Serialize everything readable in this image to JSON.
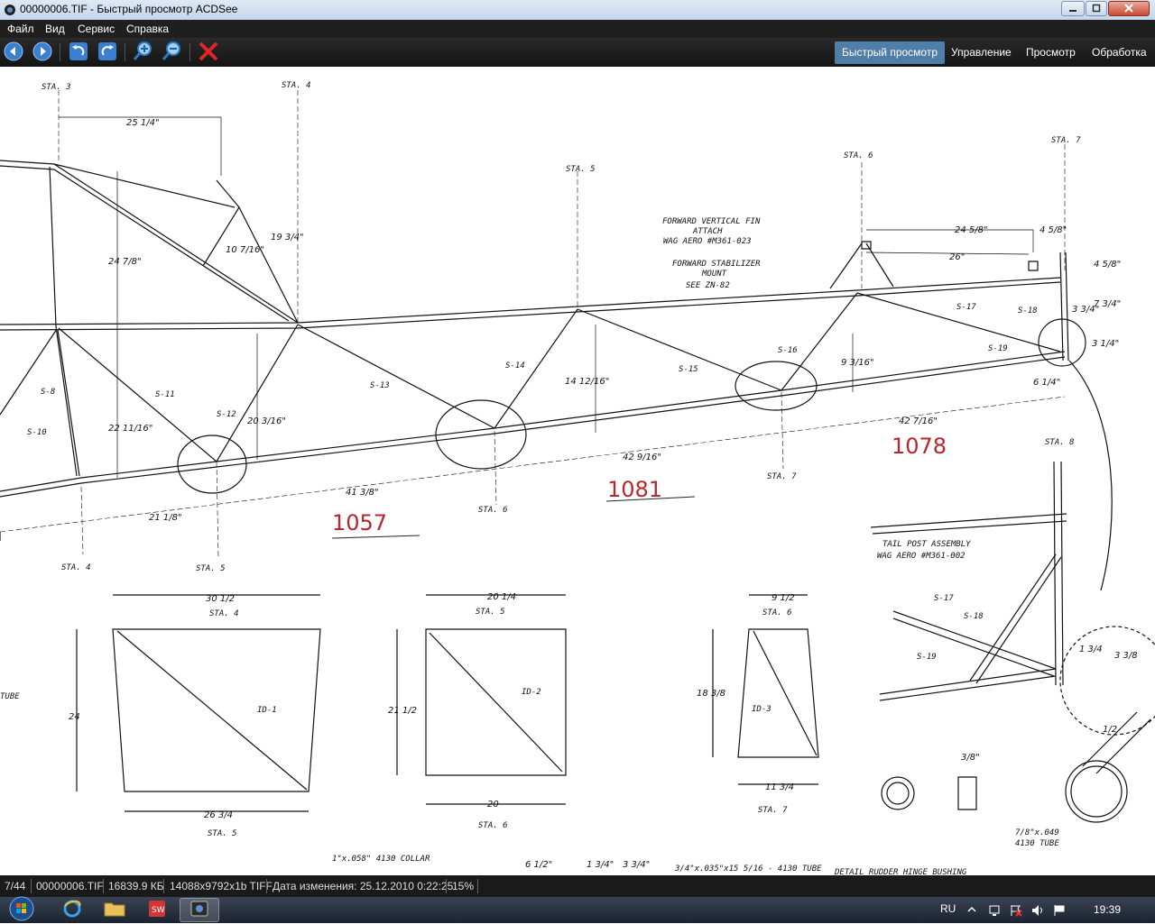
{
  "window": {
    "title": "00000006.TIF - Быстрый просмотр ACDSee",
    "minimize_icon": "minimize-icon",
    "maximize_icon": "maximize-icon",
    "close_icon": "close-icon"
  },
  "menu": {
    "items": [
      {
        "label": "Файл"
      },
      {
        "label": "Вид"
      },
      {
        "label": "Сервис"
      },
      {
        "label": "Справка"
      }
    ]
  },
  "toolbar": {
    "buttons": [
      {
        "icon": "arrow-left-icon"
      },
      {
        "icon": "arrow-right-icon"
      },
      {
        "icon": "rotate-left-icon"
      },
      {
        "icon": "rotate-right-icon"
      },
      {
        "icon": "zoom-in-icon"
      },
      {
        "icon": "zoom-out-icon"
      },
      {
        "icon": "delete-icon"
      }
    ],
    "mode_tabs": [
      {
        "label": "Быстрый просмотр",
        "active": true
      },
      {
        "label": "Управление",
        "active": false
      },
      {
        "label": "Просмотр",
        "active": false
      },
      {
        "label": "Обработка",
        "active": false
      }
    ],
    "accent_color": "#4f7ea8"
  },
  "drawing": {
    "station_labels": {
      "sta3_top": "STA. 3",
      "sta4_top": "STA. 4",
      "sta5_top": "STA. 5",
      "sta6_top": "STA. 6",
      "sta7_top": "STA. 7",
      "sta8": "STA. 8",
      "sta4_bottom": "STA. 4",
      "sta5_bottom": "STA. 5",
      "sta6_bottom": "STA. 6",
      "sta7_bottom": "STA. 7"
    },
    "notes": {
      "forward_vertical_fin": "FORWARD VERTICAL FIN",
      "attach": "ATTACH",
      "wag_aero_fin": "WAG AERO #M361-023",
      "forward_stabilizer": "FORWARD STABILIZER",
      "mount": "MOUNT",
      "see_zn": "SEE ZN-82",
      "tail_post": "TAIL POST ASSEMBLY",
      "wag_aero_post": "WAG AERO #M361-002",
      "collar": "1\"x.058\" 4130 COLLAR",
      "tube_note": "7/8\"x.049",
      "tube_note2": "4130 TUBE",
      "tube_bottom": "3/4\"x.035\"x15 5/16 - 4130 TUBE",
      "bushing_note": "DETAIL RUDDER HINGE BUSHING",
      "tube_left": "TUBE"
    },
    "member_labels": {
      "s11": "S-11",
      "s12": "S-12",
      "s13": "S-13",
      "s14": "S-14",
      "s15": "S-15",
      "s16": "S-16",
      "s17": "S-17",
      "s18": "S-18",
      "s19": "S-19",
      "s8": "S-8",
      "s10": "S-10",
      "s17b": "S-17",
      "s18b": "S-18",
      "s19b": "S-19",
      "id1": "ID-1",
      "id2": "ID-2",
      "id3": "ID-3"
    },
    "dimensions": {
      "d25": "25 1/4\"",
      "d24_7_8": "24 7/8\"",
      "d10": "10 7/16\"",
      "d19": "19 3/4\"",
      "d22": "22 11/16\"",
      "d20": "20 3/16\"",
      "d14": "14 12/16\"",
      "d9": "9 3/16\"",
      "d41": "41 3/8\"",
      "d21": "21 1/8\"",
      "d42a": "42 9/16\"",
      "d42b": "42 7/16\"",
      "d24b": "24 5/8\"",
      "d26": "26\"",
      "d4a": "4 5/8\"",
      "d4b": "4 5/8\"",
      "d6": "6 1/4\"",
      "d3": "3 3/4\"",
      "d7": "7 3/4\"",
      "d3b": "3 1/4\"",
      "w30": "30 1/2",
      "h24": "24",
      "w26": "26 3/4",
      "w20a": "20 1/4",
      "h21": "21 1/2",
      "w20b": "20",
      "w9": "9 1/2",
      "h18": "18 3/8",
      "w11": "11 3/4",
      "d6b": "6 1/2\"",
      "d1": "1 3/4\"",
      "d3c": "3 3/4\"",
      "d13a": "1 3/4",
      "d13b": "3 3/8",
      "d38": "3/8\"",
      "d12": "1/2"
    },
    "handwritten": {
      "n1057": "1057",
      "n1081": "1081",
      "n1078": "1078"
    },
    "annotation_color": "#b8262c"
  },
  "status": {
    "position": "7/44",
    "filename": "00000006.TIF",
    "filesize": "16839.9 КБ",
    "dimensions": "14088x9792x1b TIFF",
    "modified": "Дата изменения: 25.12.2010 0:22:25",
    "zoom": "15%"
  },
  "taskbar": {
    "start_icon": "windows-start-icon",
    "apps": [
      {
        "icon": "internet-explorer-icon"
      },
      {
        "icon": "folder-icon"
      },
      {
        "icon": "solidworks-icon"
      },
      {
        "icon": "acdsee-icon",
        "active": true
      }
    ],
    "language": "RU",
    "time": "19:39"
  }
}
